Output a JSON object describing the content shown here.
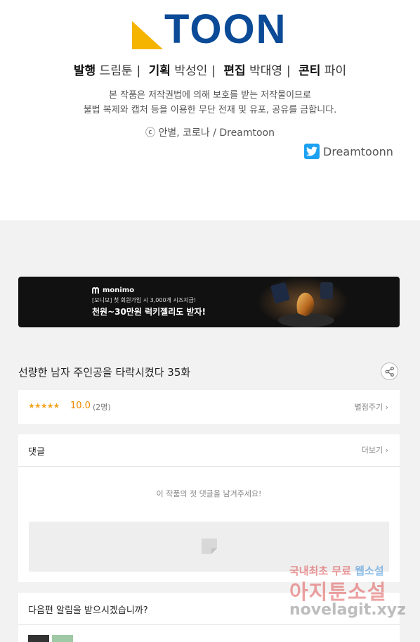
{
  "colors": {
    "brand_blue": "#0b4a96",
    "brand_yellow": "#f5b400",
    "star": "#f5a623",
    "score": "#f08a00",
    "twitter": "#1da1f2"
  },
  "credits": {
    "logo_text": "TOON",
    "publisher_label": "발행",
    "publisher": "드림툰",
    "planning_label": "기획",
    "planning": "박성인",
    "editor_label": "편집",
    "editor": "박대영",
    "content_label": "콘티",
    "content": "파이",
    "notice_line1": "본 작품은 저작권법에 의해 보호를 받는 저작물이므로",
    "notice_line2": "불법 복제와 캡처 등을 이용한 무단 전재 및 유포, 공유를 금합니다.",
    "copyright": "ⓒ 안별, 코로나 / Dreamtoon",
    "twitter_handle": "Dreamtoonn",
    "twitter_icon": "twitter-bird-icon"
  },
  "banner": {
    "brand": "monimo",
    "sub": "[모니모] 첫 회원가입 시 3,000개 시즈지급!",
    "main": "천원~30만원 럭키젤리도 받자!"
  },
  "episode": {
    "title": "선량한 남자 주인공을 타락시켰다 35화",
    "share_icon": "share-icon"
  },
  "rating": {
    "stars": "★★★★★",
    "score": "10.0",
    "count": "(2명)",
    "rate_link": "별점주기"
  },
  "comments": {
    "title": "댓글",
    "more": "더보기",
    "empty": "이 작품의 첫 댓글을 남겨주세요!"
  },
  "notify": {
    "title": "다음편 알림을 받으시겠습니까?"
  },
  "watermark": {
    "line1_a": "국내최초 무료 ",
    "line1_b": "웹소설",
    "line2": "아지툰소설",
    "line3": "novelagit.xyz"
  }
}
